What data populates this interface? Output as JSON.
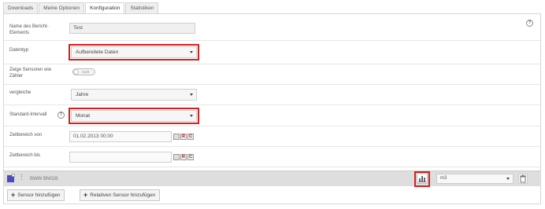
{
  "tabs": [
    {
      "label": "Downloads",
      "active": false
    },
    {
      "label": "Meine Optionen",
      "active": false
    },
    {
      "label": "Konfiguration",
      "active": true
    },
    {
      "label": "Statistiken",
      "active": false
    }
  ],
  "help_glyph": "?",
  "form": {
    "name": {
      "label": "Name des Bericht-Elements",
      "value": "Test"
    },
    "datatype": {
      "label": "Datentyp",
      "value": "Aufbereitete Daten"
    },
    "show_sensors": {
      "label": "Zeige Sensoren wie Zähler",
      "toggle_text": "AUS"
    },
    "compare": {
      "label": "vergleiche",
      "value": "Jahre"
    },
    "interval": {
      "label": "Standard-Intervall",
      "value": "Monat"
    },
    "range_from": {
      "label": "Zeitbereich von",
      "value": "01.02.2013 00:00",
      "icons": [
        "cal",
        "R",
        "C"
      ]
    },
    "range_to": {
      "label": "Zeitbereich bis",
      "value": "",
      "icons": [
        "cal",
        "R",
        "C"
      ]
    }
  },
  "sensor": {
    "color": "#4b4bc4",
    "name": "BWW BN028",
    "unit": "m3"
  },
  "buttons": {
    "add_sensor": "Sensor hinzufügen",
    "add_relative_sensor": "Relativen Sensor hinzufügen"
  },
  "colors": {
    "highlight": "#d81e1e",
    "sensor_swatch": "#4b4bc4"
  }
}
